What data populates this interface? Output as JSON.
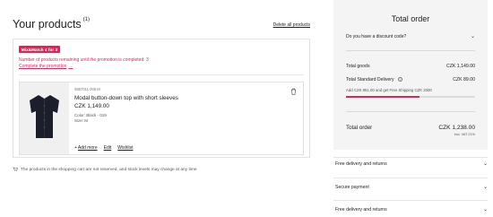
{
  "cart": {
    "title": "Your products",
    "count": "(1)",
    "delete_all": "Delete all products",
    "promo": {
      "badge": "Mix&Match 4 for 3",
      "remaining_text": "Number of products remaining until the promotion is completed: 3",
      "link": "Complete the promotion"
    },
    "item": {
      "article": "0857011 006 M",
      "name": "Modal button-down top with short sleeves",
      "price": "CZK 1,149.00",
      "color": "Color: Black - 019",
      "size": "Size: M",
      "add_more": "Add more",
      "edit": "Edit",
      "wishlist": "Wishlist",
      "image_color": "#1c1f2b"
    },
    "notice": "The products in the shopping cart are not reserved, and stock levels may change at any time"
  },
  "summary": {
    "title": "Total order",
    "discount": "Do you have a discount code?",
    "goods_label": "Total goods",
    "goods_value": "CZK 1,149.00",
    "delivery_label": "Total Standard Delivery",
    "delivery_value": "CZK 89.00",
    "free_shipping_note": "Add CZK 851.00 and get Free Shipping CZK 2000",
    "free_shipping_progress": 0.57,
    "total_label": "Total order",
    "total_value": "CZK 1,238.00",
    "vat_note": "Incl. VAT 21%",
    "accent": "#d6295a"
  },
  "accordions": [
    {
      "label": "Free delivery and returns"
    },
    {
      "label": "Secure payment"
    },
    {
      "label": "Free delivery and returns"
    }
  ]
}
